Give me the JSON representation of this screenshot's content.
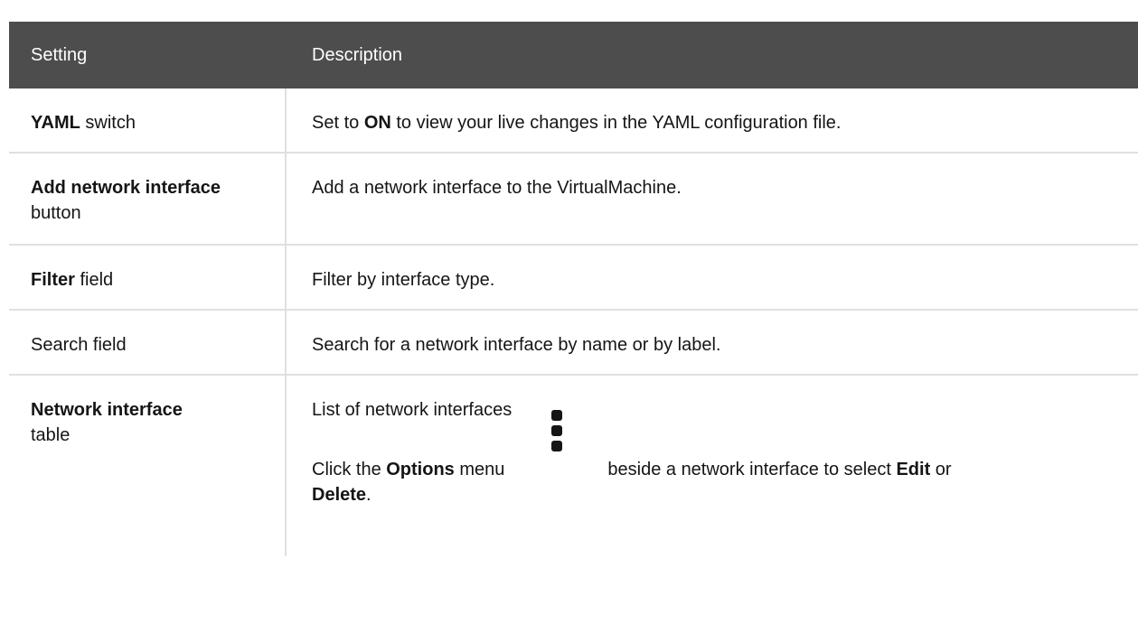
{
  "table": {
    "header": {
      "setting": "Setting",
      "description": "Description"
    },
    "rows": [
      {
        "setting_bold": "YAML",
        "setting_rest": " switch",
        "desc_pre": "Set to ",
        "desc_bold": "ON",
        "desc_post": " to view your live changes in the YAML configuration file."
      },
      {
        "setting_bold": "Add network interface",
        "setting_rest": "button",
        "desc": "Add a network interface to the VirtualMachine."
      },
      {
        "setting_bold": "Filter",
        "setting_rest": " field",
        "desc": "Filter by interface type."
      },
      {
        "setting": "Search field",
        "desc": "Search for a network interface by name or by label."
      },
      {
        "setting_bold": "Network interface",
        "setting_rest": "table",
        "desc_line1": "List of network interfaces",
        "desc2_pre": "Click the ",
        "desc2_bold1": "Options",
        "desc2_mid1": " menu",
        "desc2_icon": "kebab-icon",
        "desc2_mid2": "beside a network interface to select ",
        "desc2_bold2": "Edit",
        "desc2_mid3": " or ",
        "desc2_bold3": "Delete",
        "desc2_post": "."
      }
    ]
  }
}
